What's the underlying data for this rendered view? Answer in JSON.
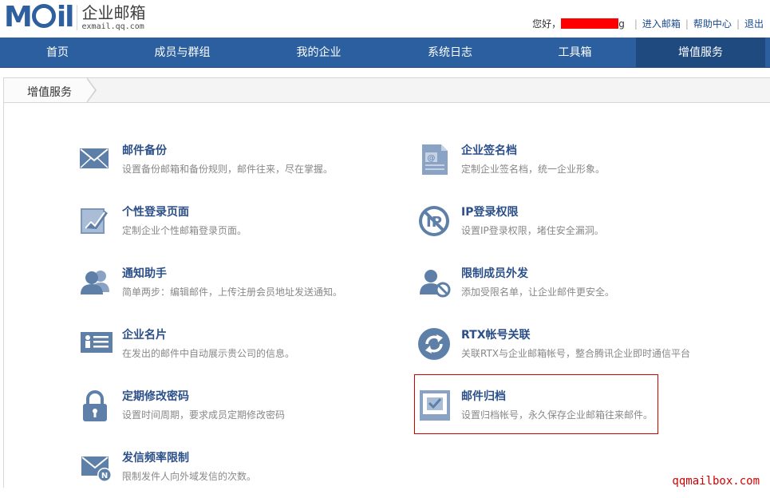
{
  "header": {
    "logo_text": "MOil",
    "product_title": "企业邮箱",
    "product_domain": "exmail.qq.com",
    "greeting": "您好，",
    "greeting_tail": "g",
    "links": [
      "进入邮箱",
      "帮助中心",
      "退出"
    ]
  },
  "nav": {
    "items": [
      "首页",
      "成员与群组",
      "我的企业",
      "系统日志",
      "工具箱",
      "增值服务"
    ],
    "active_index": 5
  },
  "breadcrumb": {
    "label": "增值服务"
  },
  "services": {
    "left": [
      {
        "name": "邮件备份",
        "desc": "设置备份邮箱和备份规则，邮件往来，尽在掌握。",
        "icon": "envelope-icon"
      },
      {
        "name": "个性登录页面",
        "desc": "定制企业个性邮箱登录页面。",
        "icon": "edit-page-icon"
      },
      {
        "name": "通知助手",
        "desc": "简单两步：编辑邮件，上传注册会员地址发送通知。",
        "icon": "users-icon"
      },
      {
        "name": "企业名片",
        "desc": "在发出的邮件中自动展示贵公司的信息。",
        "icon": "business-card-icon"
      },
      {
        "name": "定期修改密码",
        "desc": "设置时间周期，要求成员定期修改密码",
        "icon": "lock-icon"
      },
      {
        "name": "发信频率限制",
        "desc": "限制发件人向外域发信的次数。",
        "icon": "mail-limit-icon"
      }
    ],
    "right": [
      {
        "name": "企业签名档",
        "desc": "定制企业签名档，统一企业形象。",
        "icon": "signature-doc-icon"
      },
      {
        "name": "IP登录权限",
        "desc": "设置IP登录权限，堵住安全漏洞。",
        "icon": "no-ip-icon"
      },
      {
        "name": "限制成员外发",
        "desc": "添加受限名单，让企业邮件更安全。",
        "icon": "restricted-user-icon"
      },
      {
        "name": "RTX帐号关联",
        "desc": "关联RTX与企业邮箱帐号，整合腾讯企业即时通信平台",
        "icon": "sync-icon"
      },
      {
        "name": "邮件归档",
        "desc": "设置归档帐号，永久保存企业邮箱往来邮件。",
        "icon": "archive-check-icon"
      }
    ]
  },
  "watermark": "qqmailbox.com",
  "colors": {
    "nav_bg": "#2b5f9f",
    "nav_active": "#1f4a80",
    "title_blue": "#2b4f88",
    "icon_blue": "#5d7fa8",
    "highlight_red": "#d40000"
  }
}
